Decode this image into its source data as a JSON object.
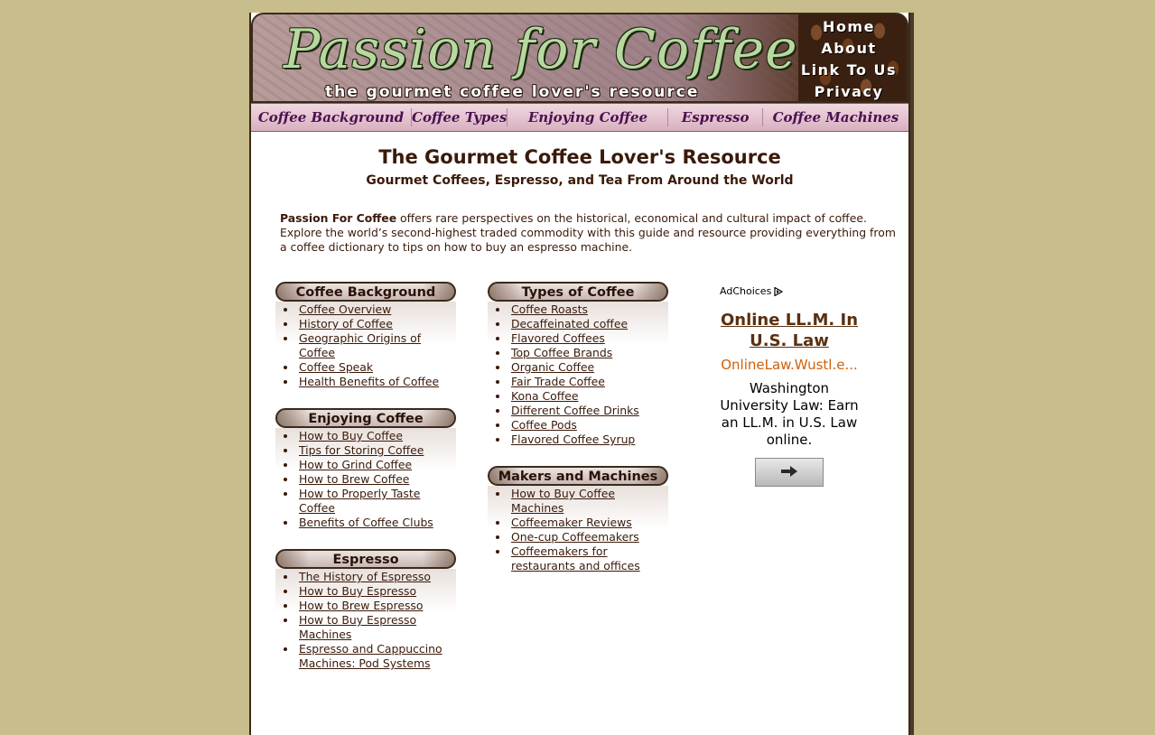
{
  "header": {
    "logo_text": "Passion for Coffee",
    "tagline": "the gourmet coffee lover's resource",
    "nav": [
      "Home",
      "About",
      "Link To Us",
      "Privacy"
    ]
  },
  "section_nav": [
    "Coffee Background",
    "Coffee Types",
    "Enjoying Coffee",
    "Espresso",
    "Coffee Machines"
  ],
  "main": {
    "headline": "The Gourmet Coffee Lover's Resource",
    "subheadline": "Gourmet Coffees, Espresso, and Tea From Around the World",
    "intro_bold": "Passion For Coffee",
    "intro_text": " offers rare perspectives on the historical, economical and cultural impact of coffee. Explore the world’s second-highest traded commodity with this guide and resource providing everything from a coffee dictionary to tips on how to buy an espresso machine."
  },
  "boxes": {
    "background": {
      "title": "Coffee Background",
      "links": [
        "Coffee Overview",
        "History of Coffee",
        "Geographic Origins of Coffee",
        "Coffee Speak",
        "Health Benefits of Coffee"
      ]
    },
    "enjoying": {
      "title": "Enjoying Coffee",
      "links": [
        "How to Buy Coffee",
        "Tips for Storing Coffee",
        "How to Grind Coffee",
        "How to Brew Coffee",
        "How to Properly Taste Coffee",
        "Benefits of Coffee Clubs"
      ]
    },
    "espresso": {
      "title": "Espresso",
      "links": [
        "The History of Espresso",
        "How to Buy Espresso",
        "How to Brew Espresso",
        "How to Buy Espresso Machines",
        "Espresso and Cappuccino Machines: Pod Systems"
      ]
    },
    "types": {
      "title": "Types of Coffee",
      "links": [
        "Coffee Roasts",
        "Decaffeinated coffee",
        "Flavored Coffees",
        "Top Coffee Brands",
        "Organic Coffee",
        "Fair Trade Coffee",
        "Kona Coffee",
        "Different Coffee Drinks",
        "Coffee Pods",
        "Flavored Coffee Syrup"
      ]
    },
    "machines": {
      "title": "Makers and Machines",
      "links": [
        "How to Buy Coffee Machines",
        "Coffeemaker Reviews",
        "One-cup Coffeemakers",
        "Coffeemakers for restaurants and offices"
      ]
    }
  },
  "ad": {
    "choices_label": "AdChoices",
    "title": "Online LL.M. In U.S. Law",
    "url": "OnlineLaw.Wustl.e...",
    "description": "Washington University Law: Earn an LL.M. in U.S. Law online."
  },
  "colors": {
    "page_background": "#c8bd8c",
    "text_brown": "#3a1a0a",
    "nav_purple": "#4a1050",
    "ad_url_orange": "#d0600a"
  }
}
